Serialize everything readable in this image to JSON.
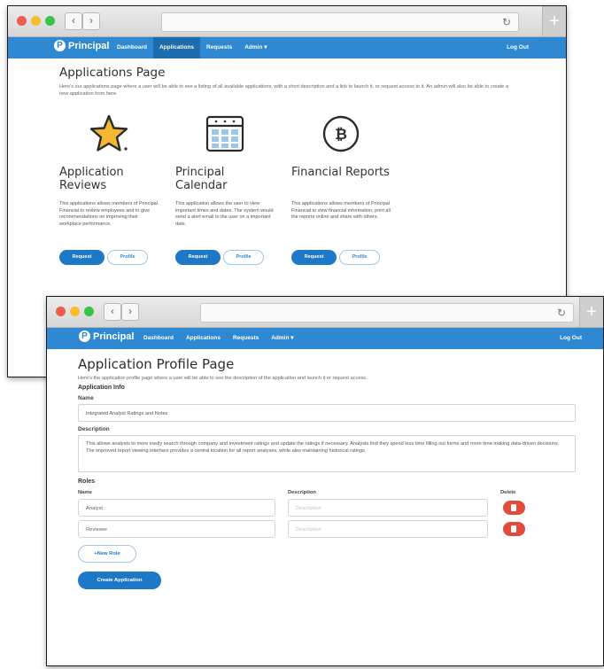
{
  "brand": {
    "name": "Principal",
    "mark": "P",
    "color": "#2e89d2"
  },
  "nav": {
    "items": [
      "Dashboard",
      "Applications",
      "Requests",
      "Admin ▾"
    ],
    "active": "Applications",
    "logout": "Log Out"
  },
  "window1": {
    "title": "Applications Page",
    "intro": "Here's our applications page where a user will be able to see a listing of all available applications, with a short description and a link to launch it, or request access to it. An admin will also be able to create a new application from here.",
    "cards": [
      {
        "title": "Application Reviews",
        "icon": "star-icon",
        "desc": "This applications allows members of Principal Financial to review employees and to give recommendations on improving their workplace performance.",
        "request": "Request",
        "profile": "Profile"
      },
      {
        "title": "Principal Calendar",
        "icon": "calendar-icon",
        "desc": "This application allows the user to view important times and dates. The system would send a alert email to the user on a important date.",
        "request": "Request",
        "profile": "Profile"
      },
      {
        "title": "Financial Reports",
        "icon": "bitcoin-icon",
        "desc": "This applications allows members of Principal Financial to view financial information, print all the reports online and share with others.",
        "request": "Request",
        "profile": "Profile"
      }
    ]
  },
  "window2": {
    "title": "Application Profile Page",
    "intro": "Here's the application profile page where a user will be able to see the description of the application and launch it or request access.",
    "section_info": "Application Info",
    "name_label": "Name",
    "name_value": "Integrated Analyst Ratings and Notes",
    "desc_label": "Description",
    "desc_value": "This allows analysts to more easily search through company and investment ratings and update the ratings if necessary. Analysts find they spend less time filling out forms and more time making data-driven decisions. The improved report viewing interface provides a central location for all report analyses, while also maintaining historical ratings.",
    "section_roles": "Roles",
    "roles_headers": {
      "name": "Name",
      "description": "Description",
      "delete": "Delete"
    },
    "roles": [
      {
        "name": "Analyst",
        "desc_placeholder": "Description"
      },
      {
        "name": "Reviewer",
        "desc_placeholder": "Description"
      }
    ],
    "new_role": "+New Role",
    "create": "Create Application"
  }
}
